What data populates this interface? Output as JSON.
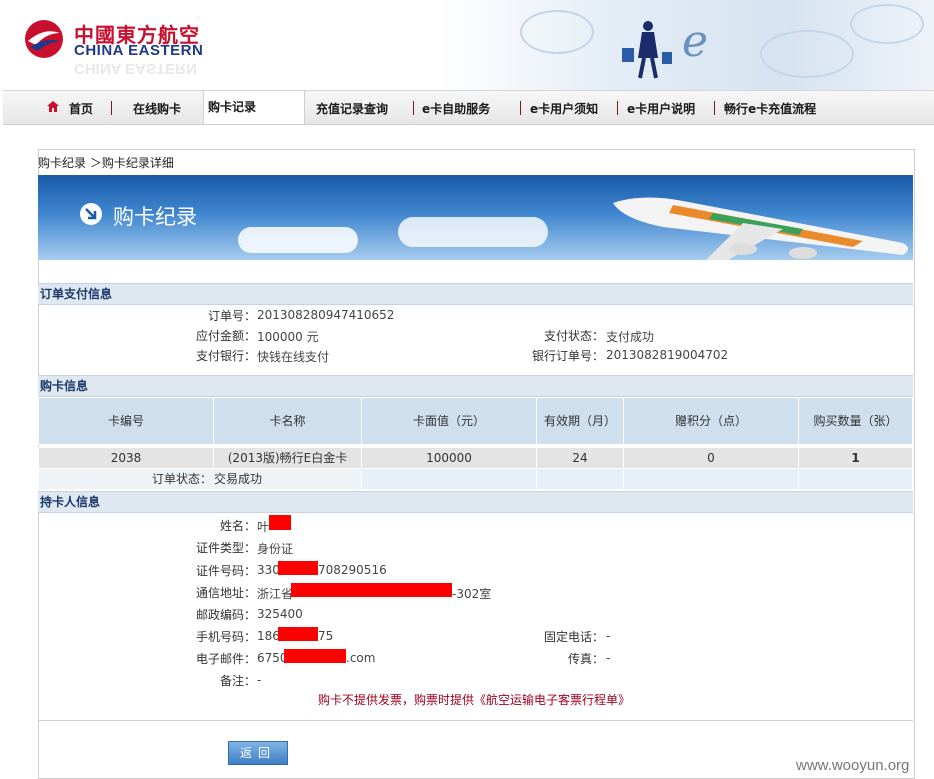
{
  "brand": {
    "cn": "中國東方航空",
    "en": "CHINA EASTERN"
  },
  "nav": {
    "items": [
      "首页",
      "在线购卡",
      "购卡记录",
      "充值记录查询",
      "e卡自助服务",
      "e卡用户须知",
      "e卡用户说明",
      "畅行e卡充值流程"
    ],
    "active": "购卡记录"
  },
  "breadcrumb": "购卡纪录 ＞购卡纪录详细",
  "banner_title": "购卡纪录",
  "payment": {
    "heading": "订单支付信息",
    "order_no_label": "订单号：",
    "order_no": "201308280947410652",
    "amount_label": "应付金额：",
    "amount": "100000 元",
    "bank_label": "支付银行：",
    "bank": "快钱在线支付",
    "status_label": "支付状态：",
    "status": "支付成功",
    "bank_order_label": "银行订单号：",
    "bank_order": "2013082819004702"
  },
  "purchase": {
    "heading": "购卡信息",
    "columns": [
      "卡编号",
      "卡名称",
      "卡面值（元）",
      "有效期（月）",
      "赠积分（点）",
      "购买数量（张）"
    ],
    "row": [
      "2038",
      "(2013版)畅行E白金卡",
      "100000",
      "24",
      "0",
      "1"
    ],
    "order_status_label": "订单状态：",
    "order_status": "交易成功"
  },
  "holder": {
    "heading": "持卡人信息",
    "name_label": "姓名：",
    "name": "叶",
    "id_type_label": "证件类型：",
    "id_type": "身份证",
    "id_no_label": "证件号码：",
    "id_no_prefix": "330",
    "id_no_suffix": "708290516",
    "address_label": "通信地址：",
    "address_prefix": "浙江省",
    "address_suffix": "-302室",
    "postcode_label": "邮政编码：",
    "postcode": "325400",
    "mobile_label": "手机号码：",
    "mobile_prefix": "186",
    "mobile_suffix": "75",
    "email_label": "电子邮件：",
    "email_prefix": "6750",
    "email_suffix": ".com",
    "remark_label": "备注：",
    "remark": "-",
    "phone_label": "固定电话：",
    "phone": "-",
    "fax_label": "传真：",
    "fax": "-"
  },
  "notice": "购卡不提供发票，购票时提供《航空运输电子客票行程单》",
  "back_button": "返回",
  "watermark": "www.wooyun.org",
  "colors": {
    "brand_red": "#c8102e",
    "brand_blue": "#1d3a8a",
    "section_bg": "#dfe7f1",
    "notice_red": "#a0001e"
  }
}
